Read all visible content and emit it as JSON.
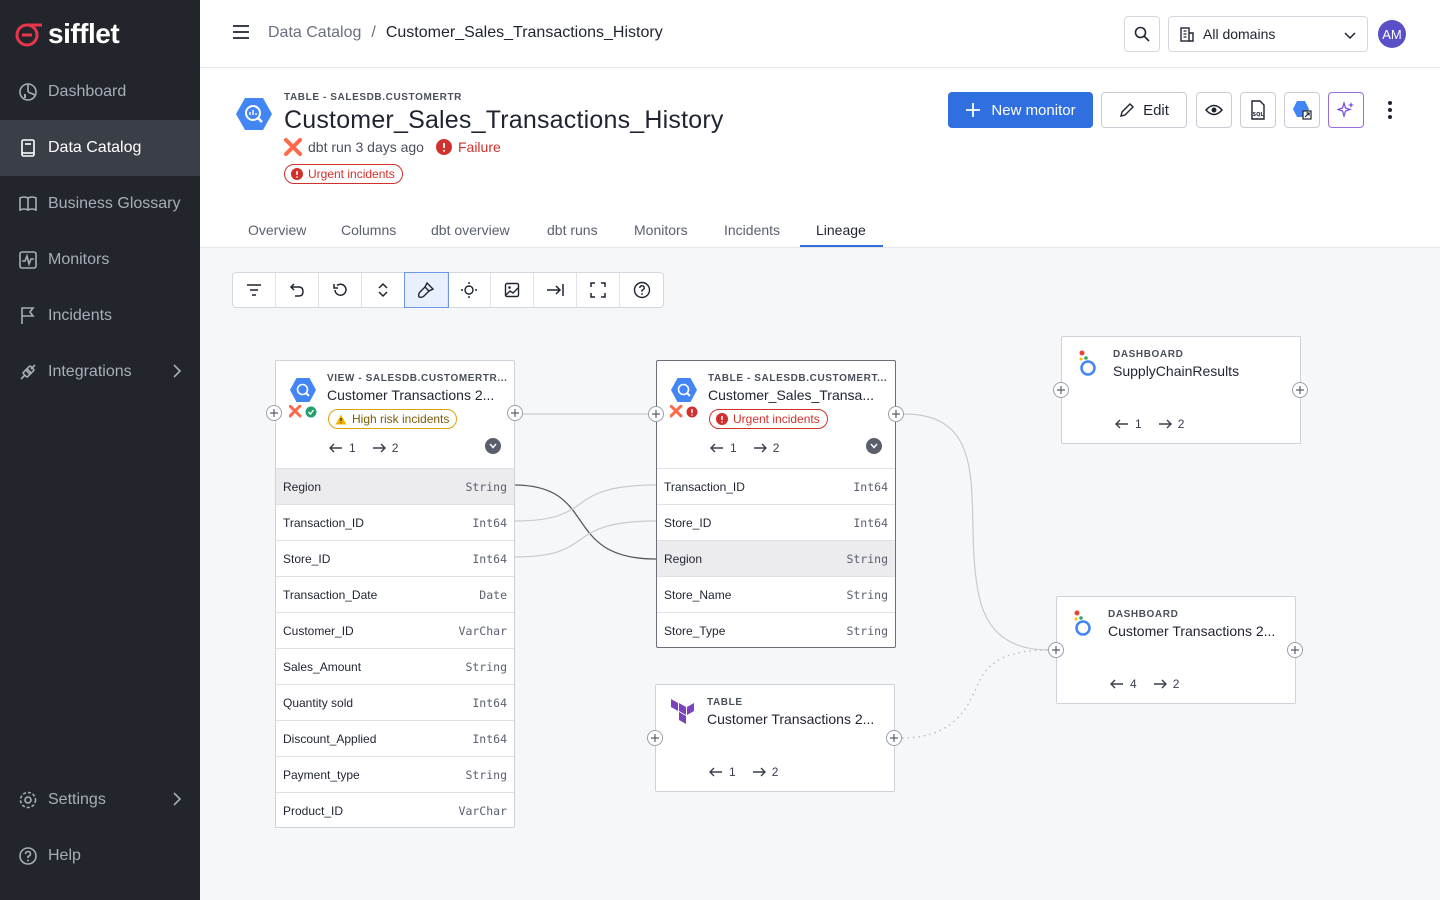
{
  "app": {
    "logo_text": "sifflet"
  },
  "sidebar": {
    "items": [
      {
        "label": "Dashboard",
        "icon": "dashboard-icon"
      },
      {
        "label": "Data Catalog",
        "icon": "book-icon",
        "active": true
      },
      {
        "label": "Business Glossary",
        "icon": "open-book-icon"
      },
      {
        "label": "Monitors",
        "icon": "monitor-icon"
      },
      {
        "label": "Incidents",
        "icon": "flag-icon"
      },
      {
        "label": "Integrations",
        "icon": "plug-icon"
      },
      {
        "label": "Settings",
        "icon": "gear-icon"
      },
      {
        "label": "Help",
        "icon": "help-icon"
      }
    ]
  },
  "header": {
    "breadcrumb_root": "Data Catalog",
    "breadcrumb_sep": "/",
    "breadcrumb_current": "Customer_Sales_Transactions_History",
    "domain_select": "All domains",
    "avatar": "AM"
  },
  "asset": {
    "type": "TABLE - SALESDB.CUSTOMERTR",
    "title": "Customer_Sales_Transactions_History",
    "dbt_run": "dbt run 3 days ago",
    "status": "Failure",
    "badge": "Urgent incidents"
  },
  "actions": {
    "new_monitor": "New monitor",
    "edit": "Edit"
  },
  "tabs": [
    "Overview",
    "Columns",
    "dbt overview",
    "dbt runs",
    "Monitors",
    "Incidents",
    "Lineage"
  ],
  "active_tab": "Lineage",
  "toolbar": [
    "filter-icon",
    "undo-icon",
    "reset-icon",
    "expand-icon",
    "brush-icon",
    "focus-icon",
    "image-icon",
    "export-icon",
    "fullscreen-icon",
    "help-icon"
  ],
  "colors": {
    "accent": "#2f6fe0",
    "danger": "#d0312d",
    "warning": "#d9a40f",
    "sidebar": "#22252c"
  },
  "lineage": {
    "node_view": {
      "type": "VIEW - SALESDB.CUSTOMERTR...",
      "title": "Customer Transactions 2...",
      "badge": "High risk incidents",
      "upstream": "1",
      "downstream": "2",
      "columns": [
        {
          "name": "Region",
          "type": "String"
        },
        {
          "name": "Transaction_ID",
          "type": "Int64"
        },
        {
          "name": "Store_ID",
          "type": "Int64"
        },
        {
          "name": "Transaction_Date",
          "type": "Date"
        },
        {
          "name": "Customer_ID",
          "type": "VarChar"
        },
        {
          "name": "Sales_Amount",
          "type": "String"
        },
        {
          "name": "Quantity sold",
          "type": "Int64"
        },
        {
          "name": "Discount_Applied",
          "type": "Int64"
        },
        {
          "name": "Payment_type",
          "type": "String"
        },
        {
          "name": "Product_ID",
          "type": "VarChar"
        }
      ]
    },
    "node_table": {
      "type": "TABLE - SALESDB.CUSTOMERT...",
      "title": "Customer_Sales_Transa...",
      "badge": "Urgent incidents",
      "upstream": "1",
      "downstream": "2",
      "columns": [
        {
          "name": "Transaction_ID",
          "type": "Int64"
        },
        {
          "name": "Store_ID",
          "type": "Int64"
        },
        {
          "name": "Region",
          "type": "String"
        },
        {
          "name": "Store_Name",
          "type": "String"
        },
        {
          "name": "Store_Type",
          "type": "String"
        }
      ]
    },
    "node_tf": {
      "type": "TABLE",
      "title": "Customer Transactions 2...",
      "upstream": "1",
      "downstream": "2"
    },
    "node_dash1": {
      "type": "DASHBOARD",
      "title": "SupplyChainResults",
      "upstream": "1",
      "downstream": "2"
    },
    "node_dash2": {
      "type": "DASHBOARD",
      "title": "Customer Transactions 2...",
      "upstream": "4",
      "downstream": "2"
    }
  }
}
